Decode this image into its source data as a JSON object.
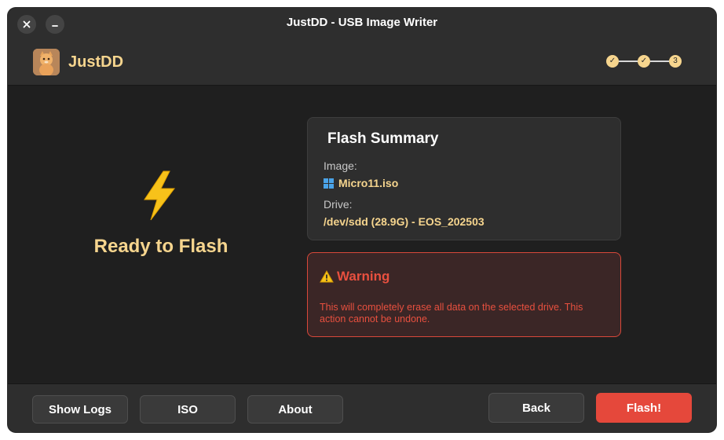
{
  "window": {
    "title": "JustDD - USB Image Writer",
    "controls": {
      "close_icon": "close-icon",
      "minimize_icon": "minimize-icon"
    }
  },
  "header": {
    "app_name": "JustDD",
    "logo_icon": "cat-logo-icon",
    "steps": [
      {
        "label": "✓",
        "state": "done"
      },
      {
        "label": "✓",
        "state": "done"
      },
      {
        "label": "3",
        "state": "current"
      }
    ]
  },
  "status": {
    "icon": "lightning-bolt-icon",
    "text": "Ready to Flash"
  },
  "summary": {
    "title": "Flash Summary",
    "image_label": "Image:",
    "image_value": "Micro11.iso",
    "image_icon": "windows-icon",
    "drive_label": "Drive:",
    "drive_value": "/dev/sdd (28.9G) - EOS_202503"
  },
  "warning": {
    "icon": "warning-icon",
    "title": "Warning",
    "message": "This will completely erase all data on the selected drive. This action cannot be undone."
  },
  "footer": {
    "show_logs": "Show Logs",
    "iso": "ISO",
    "about": "About",
    "back": "Back",
    "flash": "Flash!"
  },
  "colors": {
    "accent": "#f6d58e",
    "danger": "#e5483b",
    "background": "#1f1f1f",
    "panel": "#2e2e2e"
  }
}
